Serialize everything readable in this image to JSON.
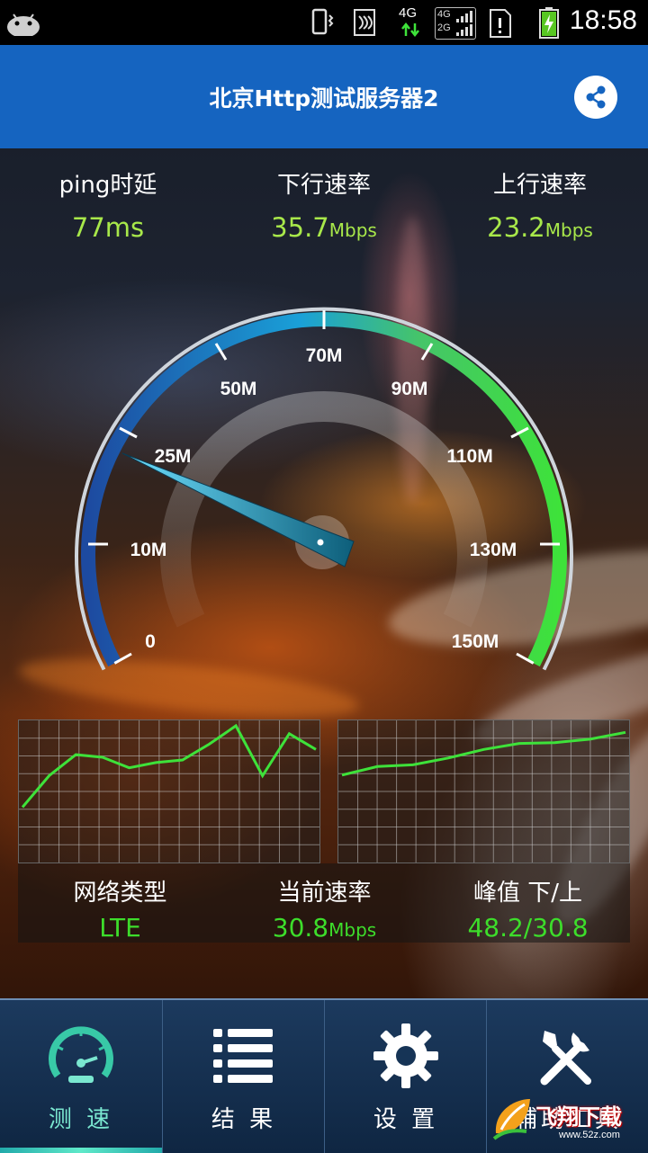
{
  "status_bar": {
    "time": "18:58",
    "network_primary": "4G",
    "network_secondary_top": "4G",
    "network_secondary_bottom": "2G",
    "icons": [
      "android-icon",
      "vibrate-icon",
      "nfc-icon",
      "data-arrows-icon",
      "signal-icon",
      "sim-alert-icon",
      "battery-charging-icon"
    ]
  },
  "header": {
    "title": "北京Http测试服务器2",
    "share_icon": "share-icon",
    "accent_color": "#1564c0"
  },
  "stats": {
    "ping": {
      "label": "ping时延",
      "value": "77ms"
    },
    "download": {
      "label": "下行速率",
      "value": "35.7",
      "unit": "Mbps"
    },
    "upload": {
      "label": "上行速率",
      "value": "23.2",
      "unit": "Mbps"
    }
  },
  "gauge": {
    "labels": [
      "0",
      "10M",
      "25M",
      "50M",
      "70M",
      "90M",
      "110M",
      "130M",
      "150M"
    ],
    "needle_value_label": "25M",
    "colors": {
      "start": "#1d4aa0",
      "mid": "#1aa0d8",
      "end": "#3ee23a"
    }
  },
  "graphs": {
    "left_series": [
      0.38,
      0.62,
      0.78,
      0.76,
      0.68,
      0.72,
      0.74,
      0.86,
      1.0,
      0.62,
      0.94,
      0.82
    ],
    "right_series": [
      0.5,
      0.6,
      0.62,
      0.7,
      0.8,
      0.87,
      0.88,
      0.92,
      1.0
    ]
  },
  "info": {
    "network_type": {
      "label": "网络类型",
      "value": "LTE"
    },
    "current_rate": {
      "label": "当前速率",
      "value": "30.8",
      "unit": "Mbps"
    },
    "peak": {
      "label": "峰值 下/上",
      "value": "48.2/30.8"
    }
  },
  "nav": {
    "items": [
      {
        "label": "测 速",
        "icon": "speedometer-icon"
      },
      {
        "label": "结 果",
        "icon": "list-icon"
      },
      {
        "label": "设 置",
        "icon": "gear-icon"
      },
      {
        "label": "辅助工具",
        "icon": "tools-icon"
      }
    ]
  },
  "watermark": {
    "text": "飞翔下载",
    "sub": "www.52z.com"
  }
}
